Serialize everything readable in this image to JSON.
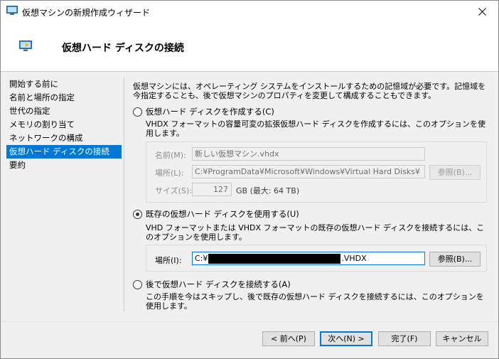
{
  "window": {
    "title": "仮想マシンの新規作成ウィザード"
  },
  "header": {
    "title": "仮想ハード ディスクの接続"
  },
  "sidebar": {
    "items": [
      {
        "label": "開始する前に",
        "selected": false
      },
      {
        "label": "名前と場所の指定",
        "selected": false
      },
      {
        "label": "世代の指定",
        "selected": false
      },
      {
        "label": "メモリの割り当て",
        "selected": false
      },
      {
        "label": "ネットワークの構成",
        "selected": false
      },
      {
        "label": "仮想ハード ディスクの接続",
        "selected": true
      },
      {
        "label": "要約",
        "selected": false
      }
    ]
  },
  "content": {
    "intro": "仮想マシンには、オペレーティング システムをインストールするための記憶域が必要です。記憶域を今指定することも、後で仮想マシンのプロパティを変更して構成することもできます。",
    "option_create": {
      "label": "仮想ハード ディスクを作成する(C)",
      "desc": "VHDX フォーマットの容量可変の拡張仮想ハード ディスクを作成するには、このオプションを使用します。",
      "name_label": "名前(M):",
      "name_value": "新しい仮想マシン.vhdx",
      "location_label": "場所(L):",
      "location_value": "C:¥ProgramData¥Microsoft¥Windows¥Virtual Hard Disks¥",
      "browse_label": "参照(B)...",
      "size_label": "サイズ(S):",
      "size_value": "127",
      "size_unit": "GB (最大: 64 TB)"
    },
    "option_existing": {
      "label": "既存の仮想ハード ディスクを使用する(U)",
      "selected": true,
      "desc": "VHD フォーマットまたは VHDX フォーマットの既存の仮想ハード ディスクを接続するには、このオプションを使用します。",
      "location_label": "場所(I):",
      "location_prefix": "C:¥",
      "location_suffix": ".VHDX",
      "browse_label": "参照(B)..."
    },
    "option_later": {
      "label": "後で仮想ハード ディスクを接続する(A)",
      "desc": "この手順を今はスキップし、後で既存の仮想ハード ディスクを接続するには、このオプションを使用します。"
    }
  },
  "footer": {
    "back_label": "< 前へ(P)",
    "next_label": "次へ(N) >",
    "finish_label": "完了(F)",
    "cancel_label": "キャンセル"
  },
  "colors": {
    "selection": "#0078d7",
    "window_bg": "#f0f0f0"
  }
}
